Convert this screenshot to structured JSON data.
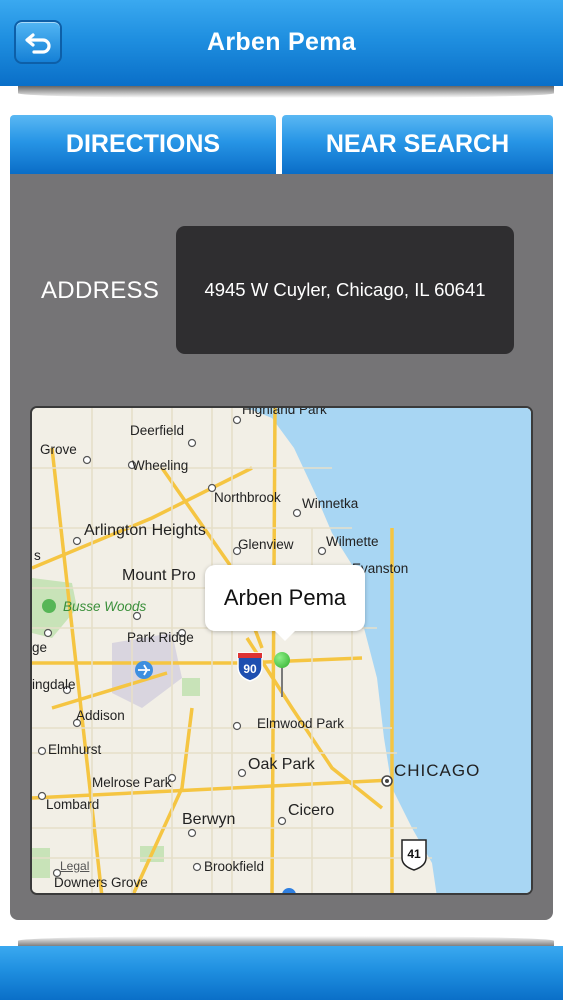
{
  "header": {
    "title": "Arben Pema"
  },
  "tabs": {
    "directions": "DIRECTIONS",
    "near_search": "NEAR SEARCH"
  },
  "address": {
    "label": "ADDRESS",
    "value": "4945 W Cuyler, Chicago, IL 60641"
  },
  "map": {
    "callout": "Arben Pema",
    "interstate_shield": "90",
    "us_shield": "41",
    "labels": {
      "highland_park": "Highland Park",
      "grove": "Grove",
      "deerfield": "Deerfield",
      "wheeling": "Wheeling",
      "northbrook": "Northbrook",
      "winnetka": "Winnetka",
      "arlington_heights": "Arlington Heights",
      "wilmette": "Wilmette",
      "glenview": "Glenview",
      "evanston": "Evanston",
      "s": "s",
      "mount_prospect": "Mount Pro",
      "busse_woods": "Busse Woods",
      "park_ridge": "Park Ridge",
      "ge": "ge",
      "ingdale": "ingdale",
      "addison": "Addison",
      "elmwood_park": "Elmwood Park",
      "elmhurst": "Elmhurst",
      "oak_park": "Oak Park",
      "chicago": "CHICAGO",
      "melrose_park": "Melrose Park",
      "lombard": "Lombard",
      "cicero": "Cicero",
      "berwyn": "Berwyn",
      "brookfield": "Brookfield",
      "legal": "Legal",
      "downers_grove": "Downers Grove"
    }
  },
  "colors": {
    "header_blue": "#1f8fe0",
    "panel_gray": "#757476",
    "address_box": "#2f2e30",
    "water": "#a8d6f3",
    "pin_green": "#2fae2a"
  },
  "icons": {
    "back": "back-arrow-icon",
    "pin": "map-pin-icon",
    "airport": "airport-icon"
  }
}
